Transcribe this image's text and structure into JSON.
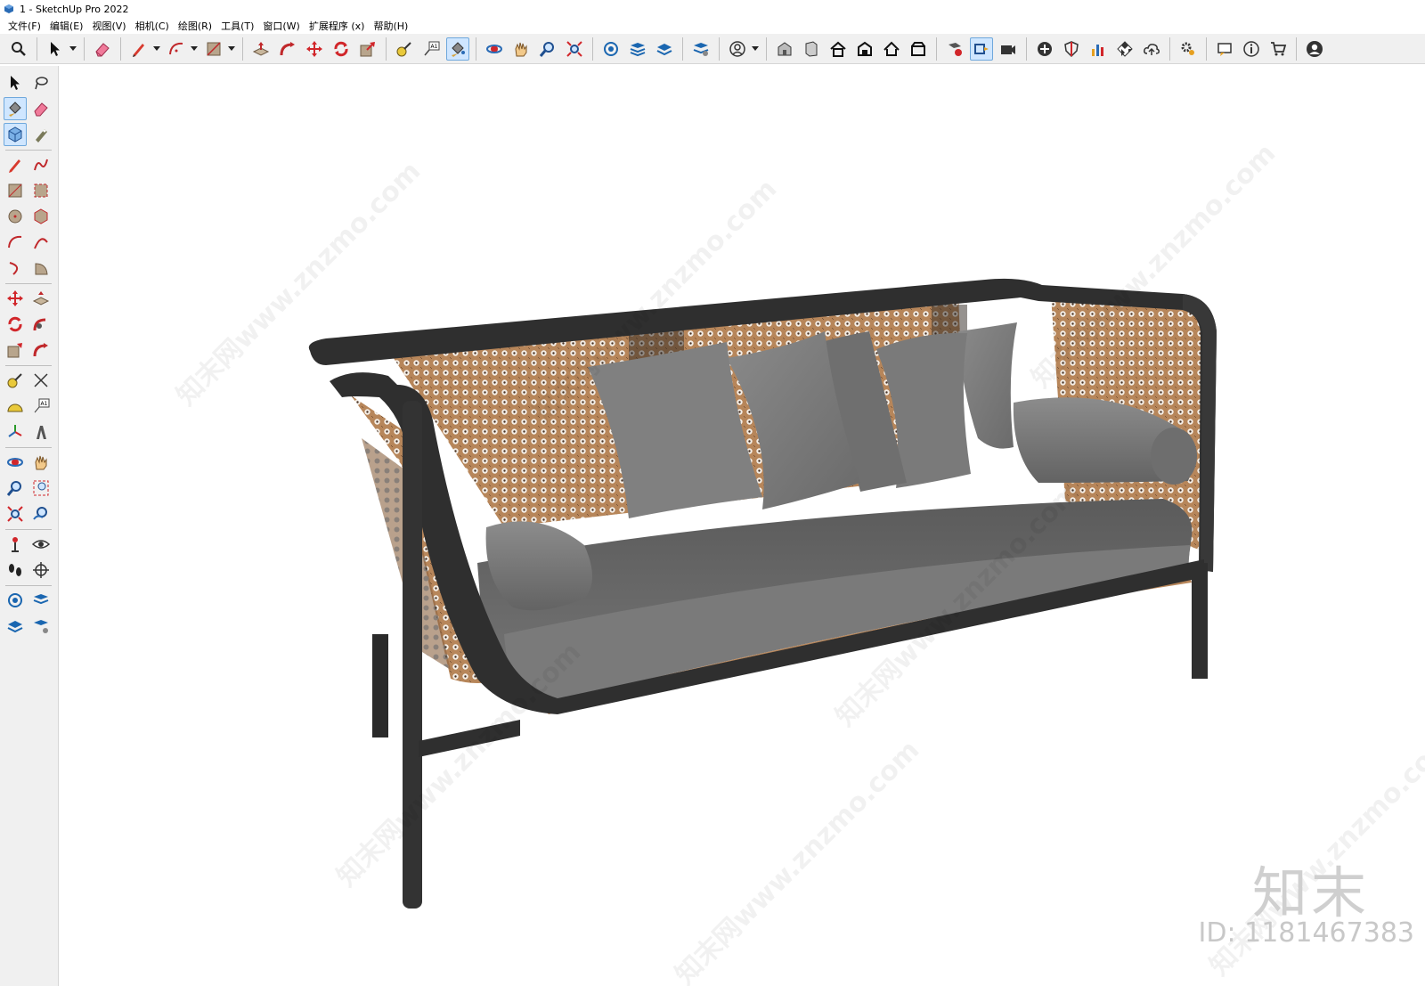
{
  "window": {
    "title": "1 - SketchUp Pro 2022"
  },
  "menu": {
    "items": [
      "文件(F)",
      "编辑(E)",
      "视图(V)",
      "相机(C)",
      "绘图(R)",
      "工具(T)",
      "窗口(W)",
      "扩展程序 (x)",
      "帮助(H)"
    ]
  },
  "toolbar": {
    "icons": [
      "search-icon",
      "select-arrow-icon",
      "eraser-icon",
      "pencil-icon",
      "arc-icon",
      "rectangle-icon",
      "push-pull-icon",
      "follow-me-icon",
      "move-icon",
      "rotate-icon",
      "scale-icon",
      "tape-measure-icon",
      "text-label-icon",
      "paint-bucket-icon",
      "orbit-icon",
      "pan-icon",
      "zoom-icon",
      "zoom-extents-icon",
      "sandbox-icon",
      "layers-icon",
      "warehouse-icon",
      "user-icon",
      "house-icon",
      "cloud-icon",
      "gear-icon",
      "help-icon",
      "cart-icon",
      "profile-icon"
    ]
  },
  "watermark": {
    "site": "知末网www.znzmo.com",
    "logo": "知末",
    "id": "ID: 1181467383"
  }
}
